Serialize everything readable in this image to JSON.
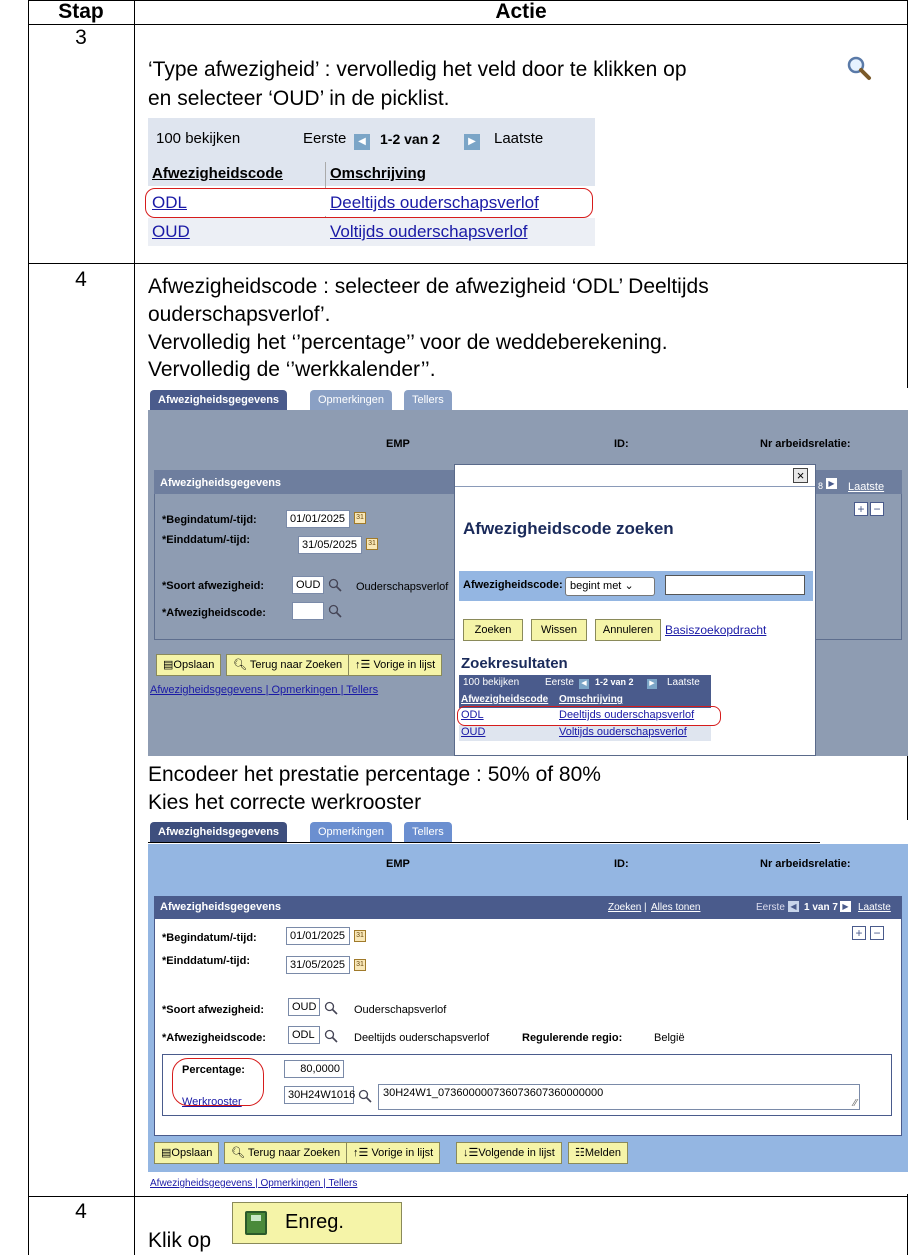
{
  "table": {
    "col_step": "Stap",
    "col_action": "Actie"
  },
  "rows": [
    {
      "step": "3",
      "line1": "‘Type afwezigheid’ : vervolledig het veld door te klikken op",
      "line2": "en selecteer ‘OUD’ in de picklist.",
      "picklist": {
        "view": "100 bekijken",
        "first": "Eerste",
        "range": "1-2 van 2",
        "last": "Laatste",
        "h1": "Afwezigheidscode",
        "h2": "Omschrijving",
        "r1c1": "ODL",
        "r1c2": "Deeltijds ouderschapsverlof",
        "r2c1": "OUD",
        "r2c2": "Voltijds ouderschapsverlof"
      }
    },
    {
      "step": "4",
      "line1": "Afwezigheidscode : selecteer de afwezigheid ‘ODL’ Deeltijds",
      "line2": "ouderschapsverlof’.",
      "line3": "Vervolledig het ‘’percentage’’ voor de weddeberekening.",
      "line4": "Vervolledig de ‘’werkkalender’’.",
      "shot1": {
        "tab1": "Afwezigheidsgegevens",
        "tab2": "Opmerkingen",
        "tab3": "Tellers",
        "emp": "EMP",
        "id": "ID:",
        "nr": "Nr arbeidsrelatie:",
        "section": "Afwezigheidsgegevens",
        "begin_label": "*Begindatum/-tijd:",
        "begin_val": "01/01/2025",
        "end_label": "*Einddatum/-tijd:",
        "end_val": "31/05/2025",
        "soort_label": "*Soort afwezigheid:",
        "soort_val": "OUD",
        "soort_desc": "Ouderschapsverlof",
        "code_label": "*Afwezigheidscode:",
        "nav_8": "8",
        "nav_last": "Laatste",
        "btn_save": "Opslaan",
        "btn_back": "Terug naar Zoeken",
        "btn_prev": "Vorige in lijst",
        "links": "Afwezigheidsgegevens | Opmerkingen | Tellers",
        "popup": {
          "close": "×",
          "title": "Afwezigheidscode zoeken",
          "field_label": "Afwezigheidscode:",
          "op": "begint met",
          "btn_search": "Zoeken",
          "btn_clear": "Wissen",
          "btn_cancel": "Annuleren",
          "basic": "Basiszoekopdracht",
          "results": "Zoekresultaten",
          "view": "100 bekijken",
          "first": "Eerste",
          "range": "1-2 van 2",
          "last": "Laatste",
          "h1": "Afwezigheidscode",
          "h2": "Omschrijving",
          "r1c1": "ODL",
          "r1c2": "Deeltijds ouderschapsverlof",
          "r2c1": "OUD",
          "r2c2": "Voltijds ouderschapsverlof"
        }
      },
      "line5": "Encodeer het prestatie percentage : 50% of 80%",
      "line6": "Kies het correcte werkrooster",
      "shot2": {
        "tab1": "Afwezigheidsgegevens",
        "tab2": "Opmerkingen",
        "tab3": "Tellers",
        "emp": "EMP",
        "id": "ID:",
        "nr": "Nr arbeidsrelatie:",
        "section": "Afwezigheidsgegevens",
        "search_link": "Zoeken",
        "all_link": "Alles tonen",
        "first": "Eerste",
        "range": "1 van 7",
        "last": "Laatste",
        "begin_label": "*Begindatum/-tijd:",
        "begin_val": "01/01/2025",
        "end_label": "*Einddatum/-tijd:",
        "end_val": "31/05/2025",
        "soort_label": "*Soort afwezigheid:",
        "soort_val": "OUD",
        "soort_desc": "Ouderschapsverlof",
        "code_label": "*Afwezigheidscode:",
        "code_val": "ODL",
        "code_desc": "Deeltijds ouderschapsverlof",
        "region_label": "Regulerende regio:",
        "region_val": "België",
        "pct_label": "Percentage:",
        "pct_val": "80,0000",
        "rooster_label": "Werkrooster",
        "rooster_val": "30H24W1016",
        "rooster_desc": "30H24W1_073600000736073607360000000",
        "btn_save": "Opslaan",
        "btn_back": "Terug naar Zoeken",
        "btn_prev": "Vorige in lijst",
        "btn_next": "Volgende in lijst",
        "btn_report": "Melden",
        "links": "Afwezigheidsgegevens | Opmerkingen | Tellers"
      }
    },
    {
      "step": "4",
      "line1": "Klik op",
      "button": "Enreg."
    }
  ],
  "colors": {
    "header_blue": "#4a5b8c",
    "panel_blue": "#94b6e2",
    "button_yellow": "#f5f4a8",
    "annotation_red": "#d61c1c"
  }
}
